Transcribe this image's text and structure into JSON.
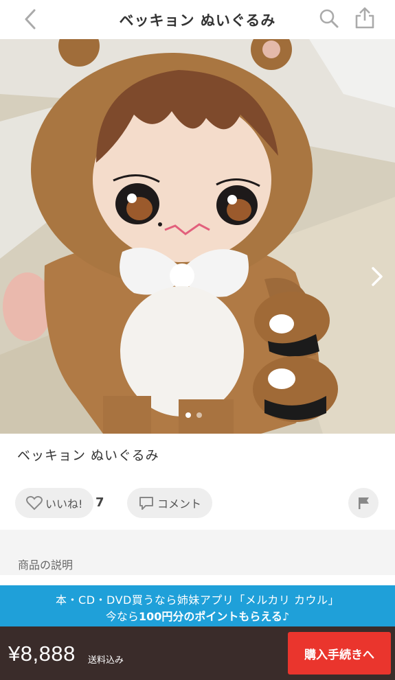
{
  "header": {
    "title": "ベッキョン ぬいぐるみ",
    "back_icon": "chevron-left-icon",
    "search_icon": "search-icon",
    "share_icon": "share-icon"
  },
  "gallery": {
    "image_count": 2,
    "current_index": 0,
    "next_icon": "chevron-right-icon"
  },
  "product": {
    "name": "ベッキョン ぬいぐるみ",
    "description_heading": "商品の説明"
  },
  "actions": {
    "like_label": "いいね!",
    "like_count": "7",
    "comment_label": "コメント",
    "flag_icon": "flag-icon"
  },
  "banner": {
    "line1": "本・CD・DVD買うなら姉妹アプリ「メルカリ カウル」",
    "line2_prefix": "今なら",
    "line2_bold": "100円分のポイントもらえる",
    "line2_suffix": "♪"
  },
  "footer": {
    "price": "¥8,888",
    "shipping": "送料込み",
    "buy_label": "購入手続きへ"
  },
  "colors": {
    "banner": "#1fa0d9",
    "footer": "#3a2c2a",
    "buy_button": "#ea352d"
  }
}
